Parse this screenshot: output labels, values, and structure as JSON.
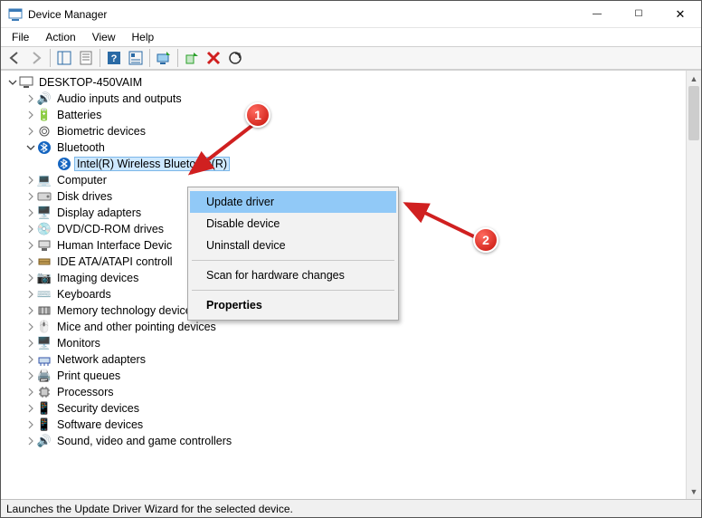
{
  "window": {
    "title": "Device Manager"
  },
  "menu": {
    "file": "File",
    "action": "Action",
    "view": "View",
    "help": "Help"
  },
  "tree": {
    "root": "DESKTOP-450VAIM",
    "items": [
      "Audio inputs and outputs",
      "Batteries",
      "Biometric devices",
      "Bluetooth",
      "Computer",
      "Disk drives",
      "Display adapters",
      "DVD/CD-ROM drives",
      "Human Interface Devic",
      "IDE ATA/ATAPI controll",
      "Imaging devices",
      "Keyboards",
      "Memory technology devices",
      "Mice and other pointing devices",
      "Monitors",
      "Network adapters",
      "Print queues",
      "Processors",
      "Security devices",
      "Software devices",
      "Sound, video and game controllers"
    ],
    "bluetooth_child": "Intel(R) Wireless Bluetooth(R)"
  },
  "context_menu": {
    "update": "Update driver",
    "disable": "Disable device",
    "uninstall": "Uninstall device",
    "scan": "Scan for hardware changes",
    "properties": "Properties"
  },
  "status": "Launches the Update Driver Wizard for the selected device.",
  "annotations": {
    "badge1": "1",
    "badge2": "2"
  }
}
